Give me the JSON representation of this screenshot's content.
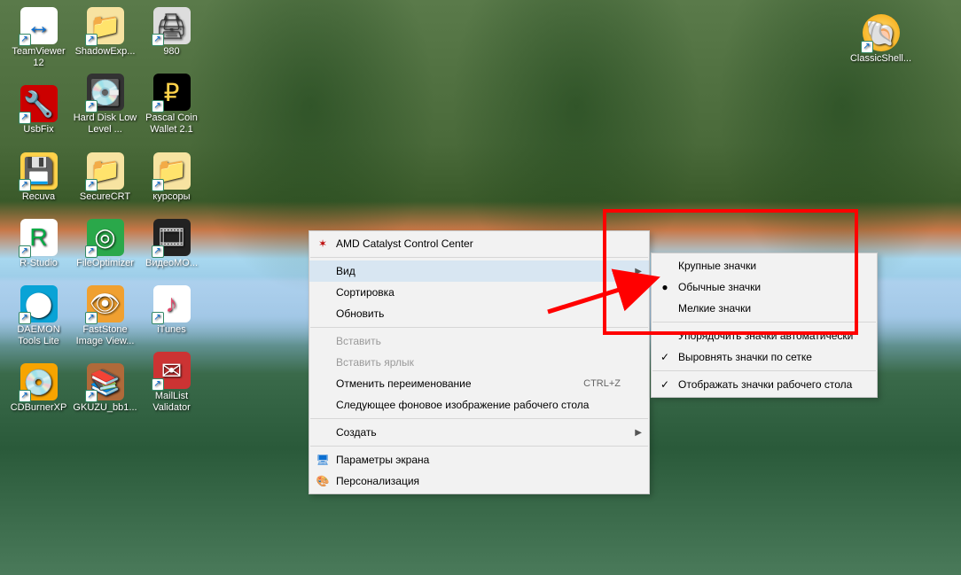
{
  "desktop": {
    "cols": [
      [
        {
          "label": "TeamViewer 12",
          "glyph": "↔",
          "bg": "#fff",
          "fg": "#0a6ed1"
        },
        {
          "label": "UsbFix",
          "glyph": "🔧",
          "bg": "#c00",
          "fg": "#fff"
        },
        {
          "label": "Recuva",
          "glyph": "💾",
          "bg": "#ffd24a",
          "fg": "#333"
        },
        {
          "label": "R-Studio",
          "glyph": "R",
          "bg": "#fff",
          "fg": "#0a4"
        },
        {
          "label": "DAEMON Tools Lite",
          "glyph": "⬤",
          "bg": "#09a3d6",
          "fg": "#fff"
        },
        {
          "label": "CDBurnerXP",
          "glyph": "💿",
          "bg": "#f7a400",
          "fg": "#034"
        }
      ],
      [
        {
          "label": "ShadowExp...",
          "glyph": "📁",
          "bg": "#f7e3a1",
          "fg": "#333"
        },
        {
          "label": "Hard Disk Low Level ...",
          "glyph": "💽",
          "bg": "#333",
          "fg": "#9cf"
        },
        {
          "label": "SecureCRT",
          "glyph": "📁",
          "bg": "#f7e3a1",
          "fg": "#333"
        },
        {
          "label": "FileOptimizer",
          "glyph": "◎",
          "bg": "#2aa84a",
          "fg": "#fff"
        },
        {
          "label": "FastStone Image View...",
          "glyph": "👁",
          "bg": "#f0a030",
          "fg": "#fff"
        },
        {
          "label": "GKUZU_bb1...",
          "glyph": "📚",
          "bg": "#b06a3a",
          "fg": "#fff"
        }
      ],
      [
        {
          "label": "980",
          "glyph": "🖨",
          "bg": "#ddd",
          "fg": "#333"
        },
        {
          "label": "Pascal Coin Wallet 2.1",
          "glyph": "₽",
          "bg": "#000",
          "fg": "#ffd24a"
        },
        {
          "label": "курсоры",
          "glyph": "📁",
          "bg": "#f7e3a1",
          "fg": "#333"
        },
        {
          "label": "ВидеоМО...",
          "glyph": "🎞",
          "bg": "#222",
          "fg": "#ccc"
        },
        {
          "label": "iTunes",
          "glyph": "♪",
          "bg": "#fff",
          "fg": "#e2476b"
        },
        {
          "label": "MailList Validator",
          "glyph": "✉",
          "bg": "#c33",
          "fg": "#fff"
        }
      ]
    ],
    "classic_shell": {
      "label": "ClassicShell...",
      "glyph": "🐚"
    }
  },
  "context_menu": {
    "item_amd": "AMD Catalyst Control Center",
    "item_view": "Вид",
    "item_sort": "Сортировка",
    "item_refresh": "Обновить",
    "item_paste": "Вставить",
    "item_paste_shortcut": "Вставить ярлык",
    "item_undo_rename": "Отменить переименование",
    "item_undo_rename_shortcut": "CTRL+Z",
    "item_next_wallpaper": "Следующее фоновое изображение рабочего стола",
    "item_new": "Создать",
    "item_display": "Параметры экрана",
    "item_personalize": "Персонализация"
  },
  "view_submenu": {
    "large": "Крупные значки",
    "medium": "Обычные значки",
    "small": "Мелкие значки",
    "auto_arrange": "Упорядочить значки автоматически",
    "align": "Выровнять значки по сетке",
    "show": "Отображать значки рабочего стола"
  }
}
